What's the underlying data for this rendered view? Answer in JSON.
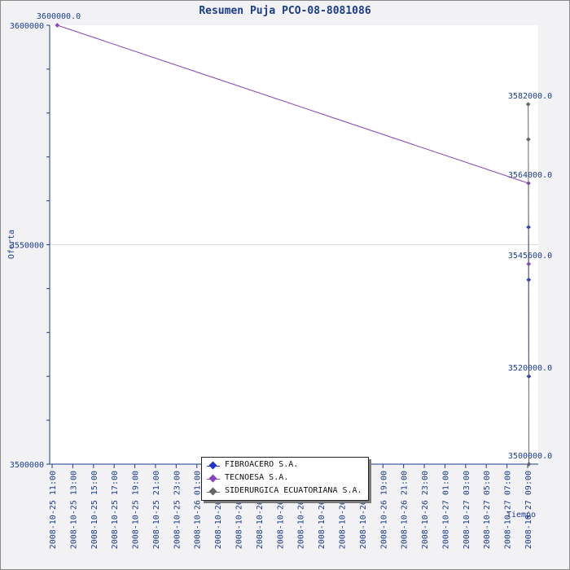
{
  "chart_data": {
    "type": "line",
    "title": "Resumen Puja PCO-08-8081086",
    "xlabel": "Tiempo",
    "ylabel": "Oferta",
    "ylim": [
      3500000,
      3600000
    ],
    "y_tick_labels": [
      "3600000",
      "3550000",
      "3500000"
    ],
    "x_tick_labels": [
      "2008-10-25 11:00",
      "2008-10-25 13:00",
      "2008-10-25 15:00",
      "2008-10-25 17:00",
      "2008-10-25 19:00",
      "2008-10-25 21:00",
      "2008-10-25 23:00",
      "2008-10-26 01:00",
      "2008-10-26 03:00",
      "2008-10-26 05:00",
      "2008-10-26 07:00",
      "2008-10-26 09:00",
      "2008-10-26 11:00",
      "2008-10-26 13:00",
      "2008-10-26 15:00",
      "2008-10-26 17:00",
      "2008-10-26 19:00",
      "2008-10-26 21:00",
      "2008-10-26 23:00",
      "2008-10-27 01:00",
      "2008-10-27 03:00",
      "2008-10-27 05:00",
      "2008-10-27 07:00",
      "2008-10-27 09:00"
    ],
    "grid": true,
    "legend_position": "bottom-center",
    "series": [
      {
        "name": "FIBROACERO S.A.",
        "color": "#2233cc",
        "points": [
          {
            "x": "2008-10-27 09:05",
            "y": 3554000
          },
          {
            "x": "2008-10-27 09:06",
            "y": 3542000
          },
          {
            "x": "2008-10-27 09:07",
            "y": 3520000
          }
        ]
      },
      {
        "name": "TECNOESA S.A.",
        "color": "#8844bb",
        "points": [
          {
            "x": "2008-10-25 11:30",
            "y": 3600000
          },
          {
            "x": "2008-10-27 09:05",
            "y": 3564000
          },
          {
            "x": "2008-10-27 09:06",
            "y": 3545600
          }
        ]
      },
      {
        "name": "SIDERURGICA ECUATORIANA S.A.",
        "color": "#666666",
        "points": [
          {
            "x": "2008-10-27 09:03",
            "y": 3582000
          },
          {
            "x": "2008-10-27 09:04",
            "y": 3574000
          },
          {
            "x": "2008-10-27 09:07",
            "y": 3500000
          }
        ]
      }
    ],
    "data_labels": [
      "3600000.0",
      "3582000.0",
      "3564000.0",
      "3545600.0",
      "3520000.0",
      "3500000.0"
    ]
  }
}
